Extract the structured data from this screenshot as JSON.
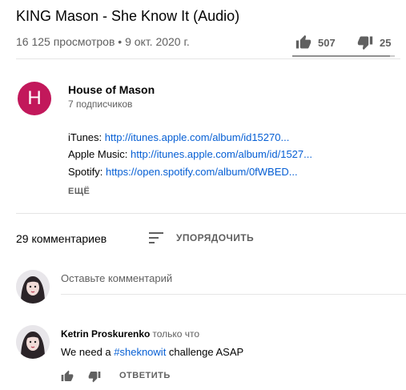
{
  "video": {
    "title": "KING Mason - She Know It (Audio)",
    "views_date": "16 125 просмотров • 9 окт. 2020 г.",
    "likes": "507",
    "dislikes": "25",
    "like_ratio": 0.953
  },
  "channel": {
    "avatar_letter": "H",
    "avatar_color": "#c2185b",
    "name": "House of Mason",
    "subscribers": "7 подписчиков"
  },
  "description": {
    "lines": [
      {
        "label": "iTunes:",
        "link": "http://itunes.apple.com/album/id15270..."
      },
      {
        "label": "Apple Music:",
        "link": "http://itunes.apple.com/album/id/1527..."
      },
      {
        "label": "Spotify:",
        "link": "https://open.spotify.com/album/0fWBED..."
      }
    ],
    "more_label": "ЕЩЁ"
  },
  "comments": {
    "count_label": "29 комментариев",
    "sort_label": "УПОРЯДОЧИТЬ",
    "add_placeholder": "Оставьте комментарий",
    "items": [
      {
        "author": "Ketrin Proskurenko",
        "time": "только что",
        "text_before": "We need a ",
        "hashtag": "#sheknowit",
        "text_after": " challenge ASAP",
        "reply_label": "ОТВЕТИТЬ"
      }
    ]
  },
  "colors": {
    "link": "#065fd4",
    "secondary_text": "#606060"
  }
}
